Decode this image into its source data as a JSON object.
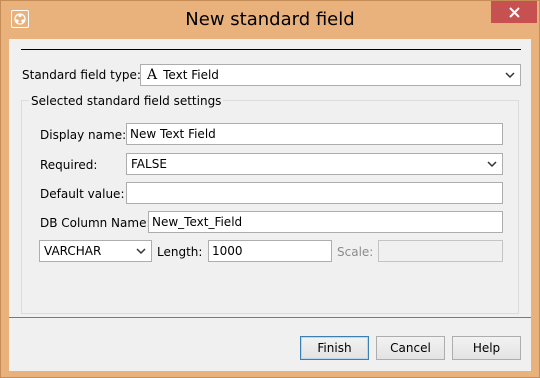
{
  "window": {
    "title": "New standard field"
  },
  "form": {
    "field_type_label": "Standard field type:",
    "field_type_value": "Text Field",
    "field_type_glyph": "A",
    "group_title": "Selected standard field settings",
    "display_name_label": "Display name:",
    "display_name_value": "New Text Field",
    "required_label": "Required:",
    "required_value": "FALSE",
    "default_value_label": "Default value:",
    "default_value_value": "",
    "db_column_label": "DB Column Name:",
    "db_column_value": "New_Text_Field",
    "data_type_value": "VARCHAR",
    "length_label": "Length:",
    "length_value": "1000",
    "scale_label": "Scale:",
    "scale_value": ""
  },
  "buttons": {
    "finish": "Finish",
    "cancel": "Cancel",
    "help": "Help"
  },
  "icons": {
    "app": "app-icon",
    "close": "close-icon",
    "dropdown": "chevron-down-icon",
    "field_type": "text-field-icon"
  },
  "colors": {
    "titlebar": "#e9b27d",
    "close_button": "#c75050",
    "client": "#f0f0f0",
    "default_button_border": "#3c7fb1"
  }
}
